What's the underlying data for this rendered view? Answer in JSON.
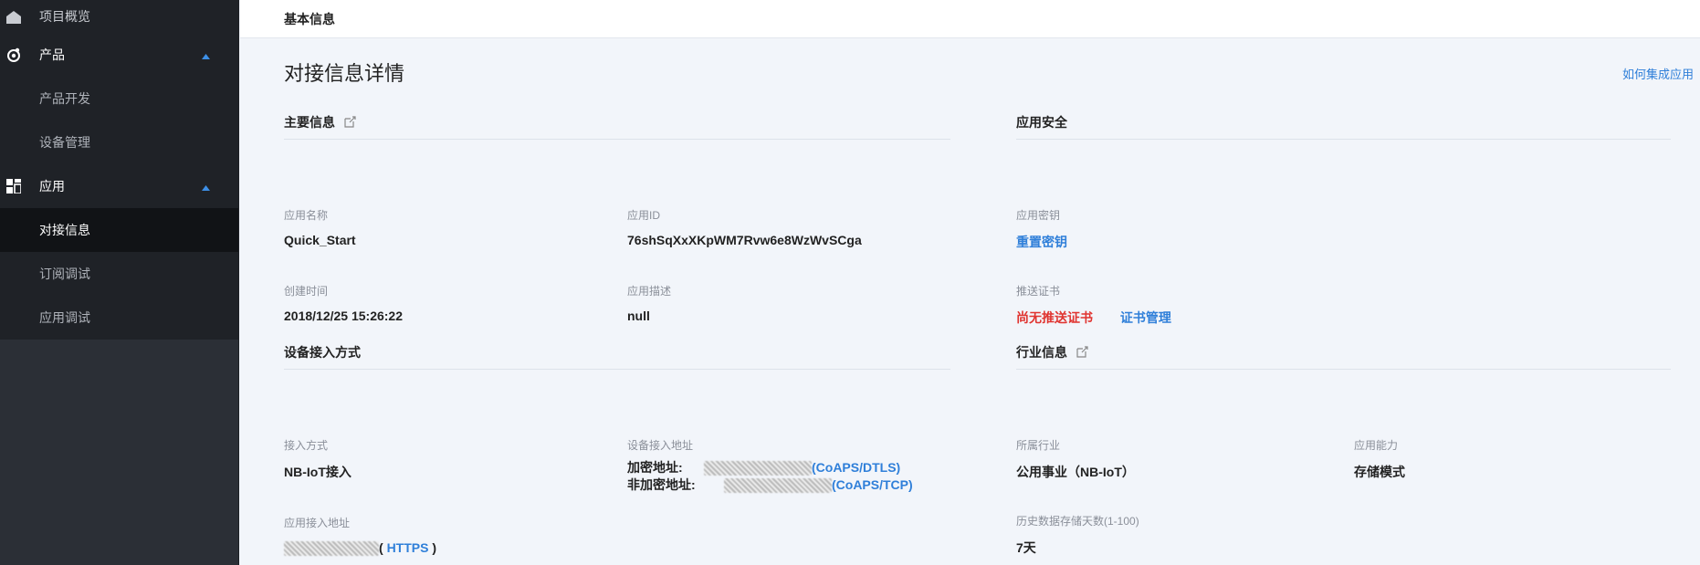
{
  "sidebar": {
    "items": [
      {
        "label": "项目概览"
      },
      {
        "label": "产品"
      },
      {
        "label": "产品开发"
      },
      {
        "label": "设备管理"
      },
      {
        "label": "应用"
      },
      {
        "label": "对接信息"
      },
      {
        "label": "订阅调试"
      },
      {
        "label": "应用调试"
      }
    ]
  },
  "header": {
    "title": "基本信息"
  },
  "page": {
    "title": "对接信息详情",
    "help_link": "如何集成应用"
  },
  "main_info": {
    "title": "主要信息",
    "app_name_label": "应用名称",
    "app_name": "Quick_Start",
    "app_id_label": "应用ID",
    "app_id": "76shSqXxXKpWM7Rvw6e8WzWvSCga",
    "created_label": "创建时间",
    "created": "2018/12/25 15:26:22",
    "desc_label": "应用描述",
    "desc": "null"
  },
  "security": {
    "title": "应用安全",
    "key_label": "应用密钥",
    "reset_key": "重置密钥",
    "cert_label": "推送证书",
    "no_cert": "尚无推送证书",
    "cert_manage": "证书管理"
  },
  "device_access": {
    "title": "设备接入方式",
    "mode_label": "接入方式",
    "mode": "NB-IoT接入",
    "addr_label": "设备接入地址",
    "enc_label": "加密地址:",
    "enc_proto": "(CoAPS/DTLS)",
    "plain_label": "非加密地址:",
    "plain_proto": "(CoAPS/TCP)",
    "app_addr_label": "应用接入地址",
    "app_addr_open": "(",
    "app_addr_proto": "HTTPS",
    "app_addr_close": ")"
  },
  "industry": {
    "title": "行业信息",
    "industry_label": "所属行业",
    "industry": "公用事业（NB-IoT）",
    "capability_label": "应用能力",
    "capability": "存储模式",
    "retention_label": "历史数据存储天数(1-100)",
    "retention": "7天"
  },
  "colors": {
    "accent": "#2f7fd9",
    "alert": "#e0332f",
    "sidebar": "#2b2f36"
  }
}
